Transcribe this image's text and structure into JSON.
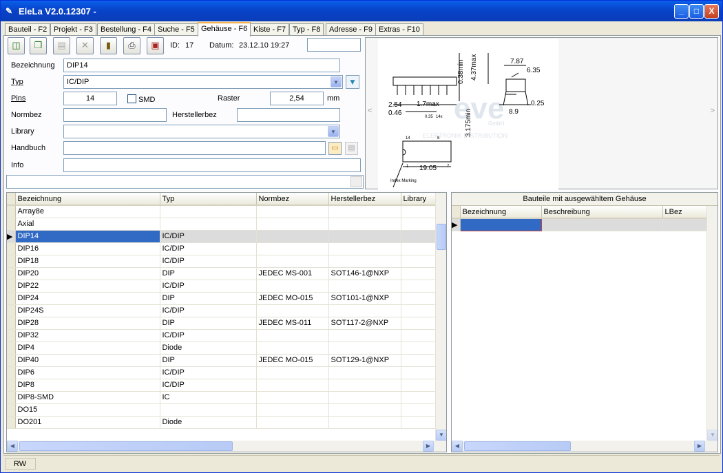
{
  "app": {
    "title": "EleLa V2.0.12307  -"
  },
  "window_controls": {
    "min": "_",
    "max": "□",
    "close": "X"
  },
  "tabs": [
    "Bauteil - F2",
    "Projekt - F3",
    "Bestellung - F4",
    "Suche - F5",
    "Gehäuse - F6",
    "Kiste - F7",
    "Typ - F8",
    "Adresse - F9",
    "Extras - F10"
  ],
  "toolbar": {
    "icons": [
      "new-icon",
      "copy-icon",
      "paste-icon",
      "delete-icon",
      "open-icon",
      "print-icon",
      "save-icon"
    ],
    "id_label": "ID:",
    "id_value": "17",
    "date_label": "Datum:",
    "date_value": "23.12.10 19:27",
    "search_value": ""
  },
  "form": {
    "bezeichnung_label": "Bezeichnung",
    "bezeichnung": "DIP14",
    "typ_label": "Typ",
    "typ": "IC/DIP",
    "pins_label": "Pins",
    "pins": "14",
    "smd_label": "SMD",
    "raster_label": "Raster",
    "raster": "2,54",
    "raster_unit": "mm",
    "normbez_label": "Normbez",
    "normbez": "",
    "herstellerbez_label": "Herstellerbez",
    "herstellerbez": "",
    "library_label": "Library",
    "library": "",
    "handbuch_label": "Handbuch",
    "handbuch": "",
    "info_label": "Info",
    "info": ""
  },
  "drawing": {
    "dims": [
      "7.87",
      "6.35",
      "0.38min",
      "4.37max",
      "2.54",
      "0.46",
      "1.7max",
      "0.35",
      "14x",
      "3.175min",
      "8.9",
      "0.25",
      "19.05",
      "14",
      "8",
      "1",
      "7"
    ],
    "index_marking": "Index Marking",
    "watermark": "eve",
    "watermark_sub": "GmbH",
    "watermark_sub2": "ELEKTRONIK DISTRIBUTION",
    "nav_left": "<",
    "nav_right": ">"
  },
  "left_grid": {
    "columns": [
      "Bezeichnung",
      "Typ",
      "Normbez",
      "Herstellerbez",
      "Library"
    ],
    "rows": [
      [
        "Array8e",
        "",
        "",
        "",
        ""
      ],
      [
        "Axial",
        "",
        "",
        "",
        ""
      ],
      [
        "DIP14",
        "IC/DIP",
        "",
        "",
        ""
      ],
      [
        "DIP16",
        "IC/DIP",
        "",
        "",
        ""
      ],
      [
        "DIP18",
        "IC/DIP",
        "",
        "",
        ""
      ],
      [
        "DIP20",
        "DIP",
        "JEDEC MS-001",
        "SOT146-1@NXP",
        ""
      ],
      [
        "DIP22",
        "IC/DIP",
        "",
        "",
        ""
      ],
      [
        "DIP24",
        "DIP",
        "JEDEC MO-015",
        "SOT101-1@NXP",
        ""
      ],
      [
        "DIP24S",
        "IC/DIP",
        "",
        "",
        ""
      ],
      [
        "DIP28",
        "DIP",
        "JEDEC MS-011",
        "SOT117-2@NXP",
        ""
      ],
      [
        "DIP32",
        "IC/DIP",
        "",
        "",
        ""
      ],
      [
        "DIP4",
        "Diode",
        "",
        "",
        ""
      ],
      [
        "DIP40",
        "DIP",
        "JEDEC MO-015",
        "SOT129-1@NXP",
        ""
      ],
      [
        "DIP6",
        "IC/DIP",
        "",
        "",
        ""
      ],
      [
        "DIP8",
        "IC/DIP",
        "",
        "",
        ""
      ],
      [
        "DIP8-SMD",
        "IC",
        "",
        "",
        ""
      ],
      [
        "DO15",
        "",
        "",
        "",
        ""
      ],
      [
        "DO201",
        "Diode",
        "",
        "",
        ""
      ]
    ],
    "selected_index": 2
  },
  "right_grid": {
    "title": "Bauteile mit ausgewähltem Gehäuse",
    "columns": [
      "Bezeichnung",
      "Beschreibung",
      "LBez"
    ]
  },
  "status": {
    "mode": "RW"
  }
}
